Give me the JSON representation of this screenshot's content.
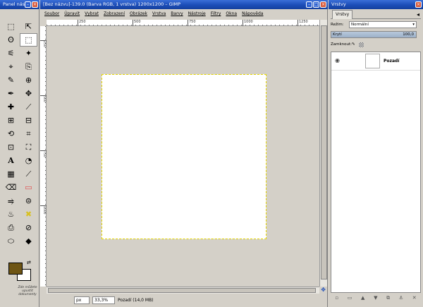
{
  "toolbox": {
    "title": "Panel nást",
    "tools": [
      "⬚",
      "⇱",
      "ʘ",
      "⬚",
      "⚟",
      "✦",
      "⌖",
      "⎘",
      "✎",
      "⊕",
      "✒",
      "✥",
      "✚",
      "⟋",
      "⊞",
      "⊟",
      "⟲",
      "⌗",
      "⊡",
      "⛶",
      "A",
      "◔",
      "▦",
      "⟋",
      "⌫",
      "▭",
      "⥤",
      "⊜",
      "♨",
      "✖",
      "⎙",
      "⊘",
      "⬭",
      "◆"
    ],
    "fg_color": "#6e5514",
    "bg_color": "#ffffff",
    "hint": "Zde můžete upustit dokumenty"
  },
  "image_window": {
    "title": "[Bez názvu]-139.0 (Barva RGB, 1 vrstva) 1200x1200 – GIMP",
    "menu": [
      "Soubor",
      "Úpravit",
      "Vybrat",
      "Zobrazení",
      "Obrázek",
      "Vrstva",
      "Barvy",
      "Nástroje",
      "Filtry",
      "Okna",
      "Nápověda"
    ],
    "ruler_h": [
      "250",
      "500",
      "750",
      "1000",
      "1250",
      "1500"
    ],
    "ruler_v": [
      "250",
      "500",
      "750",
      "1000"
    ],
    "status": {
      "unit": "px",
      "zoom": "33,3%",
      "text": "Pozadí (14,0 MB)"
    }
  },
  "layers": {
    "window_title": "Vrstvy",
    "tab": "Vrstvy",
    "mode_label": "Režim:",
    "mode_value": "Normální",
    "opacity_label": "Krytí",
    "opacity_value": "100,0",
    "lock_label": "Zamknout:",
    "layer_name": "Pozadí"
  }
}
